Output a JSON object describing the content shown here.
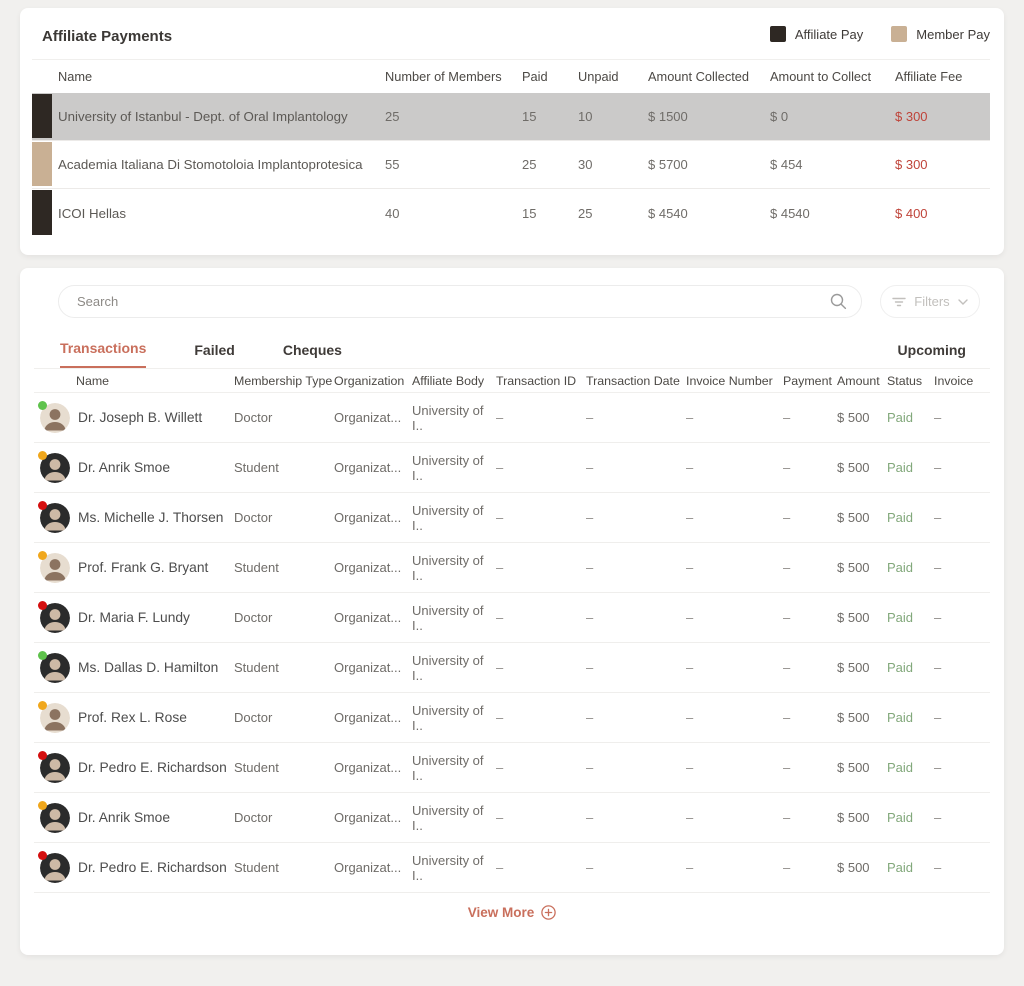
{
  "colors": {
    "page_bg": "#f1f0ee",
    "accent": "#c96f5c",
    "fee_red": "#bf4339",
    "paid_green": "#82a87b",
    "legend_dark": "#2e2823",
    "legend_tan": "#c9b094",
    "row_highlight": "#cbcac9",
    "dot_green": "#5fc24c",
    "dot_yellow": "#f0a71c",
    "dot_red": "#d40f0f"
  },
  "affiliate_payments": {
    "title": "Affiliate Payments",
    "legend": [
      {
        "label": "Affiliate Pay",
        "swatch": "dark"
      },
      {
        "label": "Member Pay",
        "swatch": "tan"
      }
    ],
    "columns": [
      "Name",
      "Number of Members",
      "Paid",
      "Unpaid",
      "Amount Collected",
      "Amount to Collect",
      "Affiliate Fee"
    ],
    "rows": [
      {
        "name": "University of Istanbul - Dept. of Oral Implantology",
        "members": "25",
        "paid": "15",
        "unpaid": "10",
        "amount_collected": "$ 1500",
        "amount_to_collect": "$ 0",
        "affiliate_fee": "$ 300",
        "bar": "dark",
        "selected": true
      },
      {
        "name": "Academia Italiana Di Stomotoloia Implantoprotesica",
        "members": "55",
        "paid": "25",
        "unpaid": "30",
        "amount_collected": "$ 5700",
        "amount_to_collect": "$ 454",
        "affiliate_fee": "$ 300",
        "bar": "tan",
        "selected": false
      },
      {
        "name": "ICOI Hellas",
        "members": "40",
        "paid": "15",
        "unpaid": "25",
        "amount_collected": "$ 4540",
        "amount_to_collect": "$ 4540",
        "affiliate_fee": "$ 400",
        "bar": "dark",
        "selected": false
      }
    ]
  },
  "transactions_panel": {
    "search": {
      "placeholder": "Search"
    },
    "filters_label": "Filters",
    "tabs": [
      {
        "label": "Transactions",
        "active": true
      },
      {
        "label": "Failed",
        "active": false
      },
      {
        "label": "Cheques",
        "active": false
      }
    ],
    "upcoming_label": "Upcoming",
    "columns": [
      "Name",
      "Membership Type",
      "Organization",
      "Affiliate Body",
      "Transaction ID",
      "Transaction Date",
      "Invoice Number",
      "Payment",
      "Amount",
      "Status",
      "Invoice"
    ],
    "rows": [
      {
        "name": "Dr. Joseph B. Willett",
        "membership": "Doctor",
        "organization": "Organizat...",
        "affiliate_body": "University of I..",
        "transaction_id": "–",
        "transaction_date": "–",
        "invoice_number": "–",
        "payment": "–",
        "amount": "$ 500",
        "status": "Paid",
        "invoice": "–",
        "dot": "green",
        "avatar": "light"
      },
      {
        "name": "Dr. Anrik Smoe",
        "membership": "Student",
        "organization": "Organizat...",
        "affiliate_body": "University of I..",
        "transaction_id": "–",
        "transaction_date": "–",
        "invoice_number": "–",
        "payment": "–",
        "amount": "$ 500",
        "status": "Paid",
        "invoice": "–",
        "dot": "yellow",
        "avatar": "dark"
      },
      {
        "name": "Ms. Michelle J. Thorsen",
        "membership": "Doctor",
        "organization": "Organizat...",
        "affiliate_body": "University of I..",
        "transaction_id": "–",
        "transaction_date": "–",
        "invoice_number": "–",
        "payment": "–",
        "amount": "$ 500",
        "status": "Paid",
        "invoice": "–",
        "dot": "red",
        "avatar": "dark"
      },
      {
        "name": "Prof. Frank G. Bryant",
        "membership": "Student",
        "organization": "Organizat...",
        "affiliate_body": "University of I..",
        "transaction_id": "–",
        "transaction_date": "–",
        "invoice_number": "–",
        "payment": "–",
        "amount": "$ 500",
        "status": "Paid",
        "invoice": "–",
        "dot": "yellow",
        "avatar": "light"
      },
      {
        "name": "Dr. Maria F. Lundy",
        "membership": "Doctor",
        "organization": "Organizat...",
        "affiliate_body": "University of I..",
        "transaction_id": "–",
        "transaction_date": "–",
        "invoice_number": "–",
        "payment": "–",
        "amount": "$ 500",
        "status": "Paid",
        "invoice": "–",
        "dot": "red",
        "avatar": "dark"
      },
      {
        "name": "Ms. Dallas D. Hamilton",
        "membership": "Student",
        "organization": "Organizat...",
        "affiliate_body": "University of I..",
        "transaction_id": "–",
        "transaction_date": "–",
        "invoice_number": "–",
        "payment": "–",
        "amount": "$ 500",
        "status": "Paid",
        "invoice": "–",
        "dot": "green",
        "avatar": "dark"
      },
      {
        "name": "Prof. Rex L. Rose",
        "membership": "Doctor",
        "organization": "Organizat...",
        "affiliate_body": "University of I..",
        "transaction_id": "–",
        "transaction_date": "–",
        "invoice_number": "–",
        "payment": "–",
        "amount": "$ 500",
        "status": "Paid",
        "invoice": "–",
        "dot": "yellow",
        "avatar": "light"
      },
      {
        "name": "Dr. Pedro E. Richardson",
        "membership": "Student",
        "organization": "Organizat...",
        "affiliate_body": "University of I..",
        "transaction_id": "–",
        "transaction_date": "–",
        "invoice_number": "–",
        "payment": "–",
        "amount": "$ 500",
        "status": "Paid",
        "invoice": "–",
        "dot": "red",
        "avatar": "dark"
      },
      {
        "name": "Dr. Anrik Smoe",
        "membership": "Doctor",
        "organization": "Organizat...",
        "affiliate_body": "University of I..",
        "transaction_id": "–",
        "transaction_date": "–",
        "invoice_number": "–",
        "payment": "–",
        "amount": "$ 500",
        "status": "Paid",
        "invoice": "–",
        "dot": "yellow",
        "avatar": "dark"
      },
      {
        "name": "Dr. Pedro E. Richardson",
        "membership": "Student",
        "organization": "Organizat...",
        "affiliate_body": "University of I..",
        "transaction_id": "–",
        "transaction_date": "–",
        "invoice_number": "–",
        "payment": "–",
        "amount": "$ 500",
        "status": "Paid",
        "invoice": "–",
        "dot": "red",
        "avatar": "dark"
      }
    ],
    "view_more_label": "View More"
  }
}
